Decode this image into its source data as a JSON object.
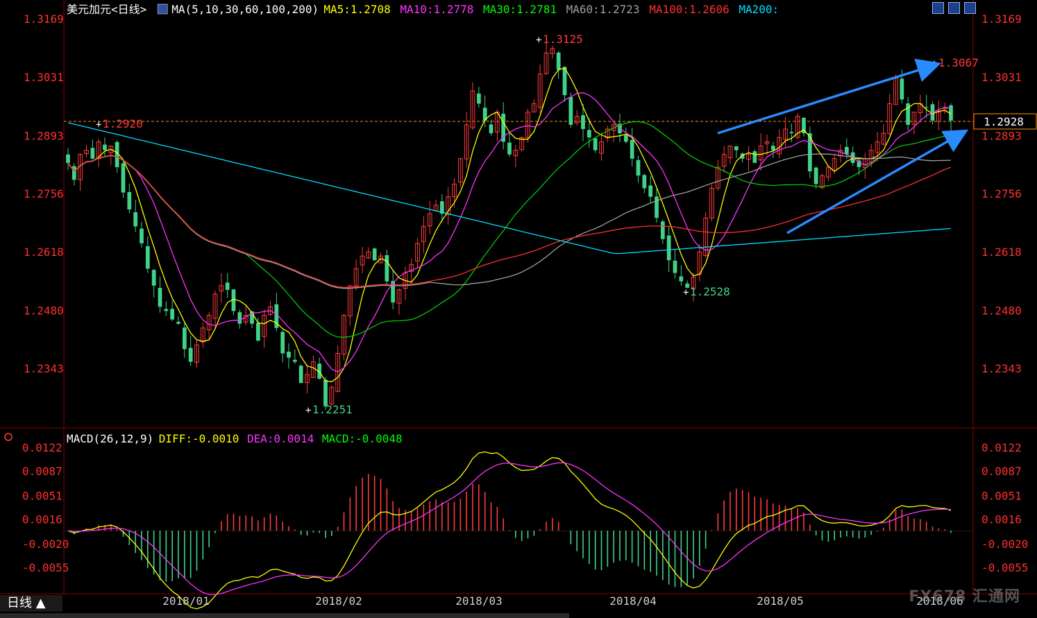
{
  "header": {
    "symbol": "美元加元<日线>",
    "ma_title": "MA(5,10,30,60,100,200)",
    "ma_values": [
      {
        "label": "MA5:",
        "value": "1.2708",
        "color": "#ffff00"
      },
      {
        "label": "MA10:",
        "value": "1.2778",
        "color": "#ff33ff"
      },
      {
        "label": "MA30:",
        "value": "1.2781",
        "color": "#00ff00"
      },
      {
        "label": "MA60:",
        "value": "1.2723",
        "color": "#a0a0a0"
      },
      {
        "label": "MA100:",
        "value": "1.2606",
        "color": "#ff3030"
      },
      {
        "label": "MA200:",
        "value": "",
        "color": "#00e0ff"
      }
    ]
  },
  "macd_header": {
    "title": "MACD(26,12,9)",
    "values": [
      {
        "label": "DIFF:",
        "value": "-0.0010",
        "color": "#ffff00"
      },
      {
        "label": "DEA:",
        "value": "0.0014",
        "color": "#ff33ff"
      },
      {
        "label": "MACD:",
        "value": "-0.0048",
        "color": "#00ff00"
      }
    ]
  },
  "timeframe": {
    "label": "日线 ▲"
  },
  "watermark": "FX678 汇通网",
  "chart_data": {
    "type": "candlestick",
    "title": "美元加元<日线>",
    "price_axis": {
      "ticks": [
        "1.3169",
        "1.3031",
        "1.2893",
        "1.2756",
        "1.2618",
        "1.2480",
        "1.2343"
      ],
      "range": [
        1.2251,
        1.3169
      ]
    },
    "current_price": "1.2928",
    "reference_level": 1.2928,
    "x_axis_labels": [
      "2018/01",
      "2018/02",
      "2018/03",
      "2018/04",
      "2018/05",
      "2018/06"
    ],
    "annotations": [
      {
        "text": "1.2920",
        "price": 1.292,
        "kind": "high"
      },
      {
        "text": "1.3125",
        "price": 1.3125,
        "kind": "high"
      },
      {
        "text": "1.2251",
        "price": 1.2251,
        "kind": "low"
      },
      {
        "text": "1.2528",
        "price": 1.2528,
        "kind": "low"
      },
      {
        "text": "1.3067",
        "price": 1.3067,
        "kind": "high"
      }
    ],
    "macd_axis": {
      "ticks": [
        "0.0122",
        "0.0087",
        "0.0051",
        "0.0016",
        "-0.0020",
        "-0.0055"
      ]
    },
    "series_summary": [
      {
        "name": "MA5",
        "value": 1.2708
      },
      {
        "name": "MA10",
        "value": 1.2778
      },
      {
        "name": "MA30",
        "value": 1.2781
      },
      {
        "name": "MA60",
        "value": 1.2723
      },
      {
        "name": "MA100",
        "value": 1.2606
      },
      {
        "name": "DIFF",
        "value": -0.001
      },
      {
        "name": "DEA",
        "value": 0.0014
      },
      {
        "name": "MACD",
        "value": -0.0048
      }
    ],
    "close_anchors": [
      1.283,
      1.279,
      1.285,
      1.286,
      1.284,
      1.288,
      1.286,
      1.287,
      1.282,
      1.276,
      1.272,
      1.268,
      1.264,
      1.258,
      1.254,
      1.249,
      1.248,
      1.246,
      1.245,
      1.239,
      1.236,
      1.24,
      1.244,
      1.247,
      1.252,
      1.254,
      1.253,
      1.248,
      1.245,
      1.247,
      1.245,
      1.241,
      1.247,
      1.249,
      1.244,
      1.238,
      1.237,
      1.236,
      1.231,
      1.233,
      1.236,
      1.232,
      1.2255,
      1.23,
      1.238,
      1.247,
      1.254,
      1.258,
      1.261,
      1.262,
      1.26,
      1.261,
      1.255,
      1.25,
      1.253,
      1.257,
      1.259,
      1.264,
      1.268,
      1.271,
      1.273,
      1.271,
      1.275,
      1.278,
      1.284,
      1.292,
      1.3,
      1.297,
      1.293,
      1.29,
      1.295,
      1.288,
      1.285,
      1.286,
      1.289,
      1.295,
      1.297,
      1.304,
      1.309,
      1.31,
      1.305,
      1.299,
      1.292,
      1.294,
      1.291,
      1.289,
      1.286,
      1.288,
      1.291,
      1.292,
      1.29,
      1.288,
      1.284,
      1.28,
      1.277,
      1.275,
      1.27,
      1.265,
      1.26,
      1.257,
      1.255,
      1.2535,
      1.256,
      1.262,
      1.27,
      1.277,
      1.282,
      1.285,
      1.287,
      1.286,
      1.284,
      1.285,
      1.283,
      1.287,
      1.288,
      1.286,
      1.289,
      1.291,
      1.29,
      1.294,
      1.29,
      1.281,
      1.278,
      1.28,
      1.282,
      1.284,
      1.286,
      1.285,
      1.283,
      1.282,
      1.284,
      1.286,
      1.288,
      1.29,
      1.297,
      1.303,
      1.298,
      1.292,
      1.295,
      1.297,
      1.296,
      1.293,
      1.295,
      1.296,
      1.293
    ]
  }
}
